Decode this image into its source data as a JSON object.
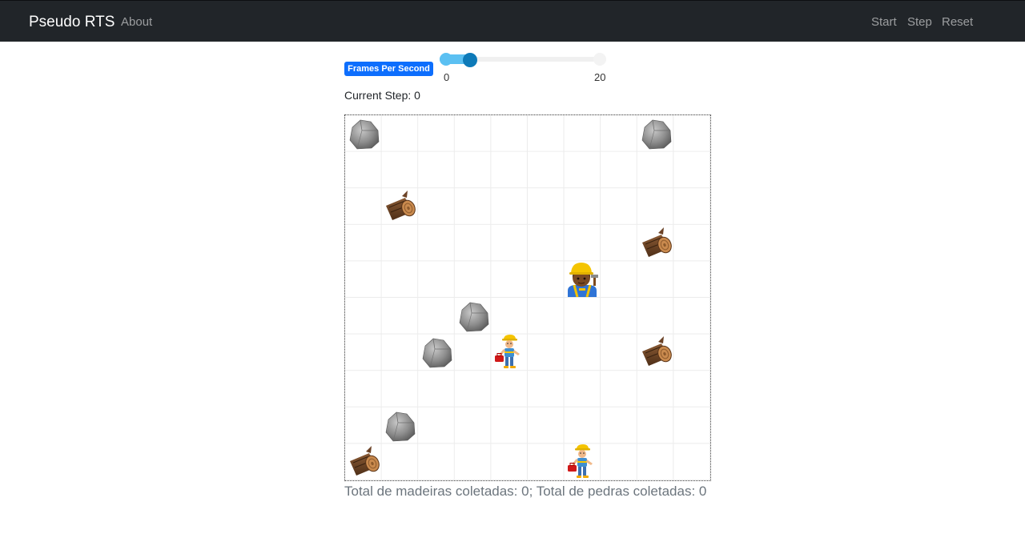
{
  "navbar": {
    "brand": "Pseudo RTS",
    "about": "About",
    "start": "Start",
    "step": "Step",
    "reset": "Reset"
  },
  "controls": {
    "fps_label": "Frames Per Second",
    "fps_min": "0",
    "fps_max": "20",
    "fps_value_fraction": 0.1,
    "current_step_label": "Current Step: 0"
  },
  "totals": "Total de madeiras coletadas: 0; Total de pedras coletadas: 0",
  "colors": {
    "navbar_bg": "#212529",
    "badge_bg": "#0d6efd",
    "slider_track": "#5bc0f2",
    "slider_handle": "#0e7ab8"
  },
  "grid": {
    "columns": 10,
    "rows": 10,
    "entities": [
      {
        "type": "rock",
        "col": 0,
        "row": 0
      },
      {
        "type": "rock",
        "col": 8,
        "row": 0
      },
      {
        "type": "wood",
        "col": 1,
        "row": 2
      },
      {
        "type": "wood",
        "col": 8,
        "row": 3
      },
      {
        "type": "female-worker",
        "col": 6,
        "row": 4
      },
      {
        "type": "rock",
        "col": 3,
        "row": 5
      },
      {
        "type": "rock",
        "col": 2,
        "row": 6
      },
      {
        "type": "builder",
        "col": 4,
        "row": 6
      },
      {
        "type": "wood",
        "col": 8,
        "row": 6
      },
      {
        "type": "rock",
        "col": 1,
        "row": 8
      },
      {
        "type": "wood",
        "col": 0,
        "row": 9
      },
      {
        "type": "builder",
        "col": 6,
        "row": 9
      }
    ]
  }
}
